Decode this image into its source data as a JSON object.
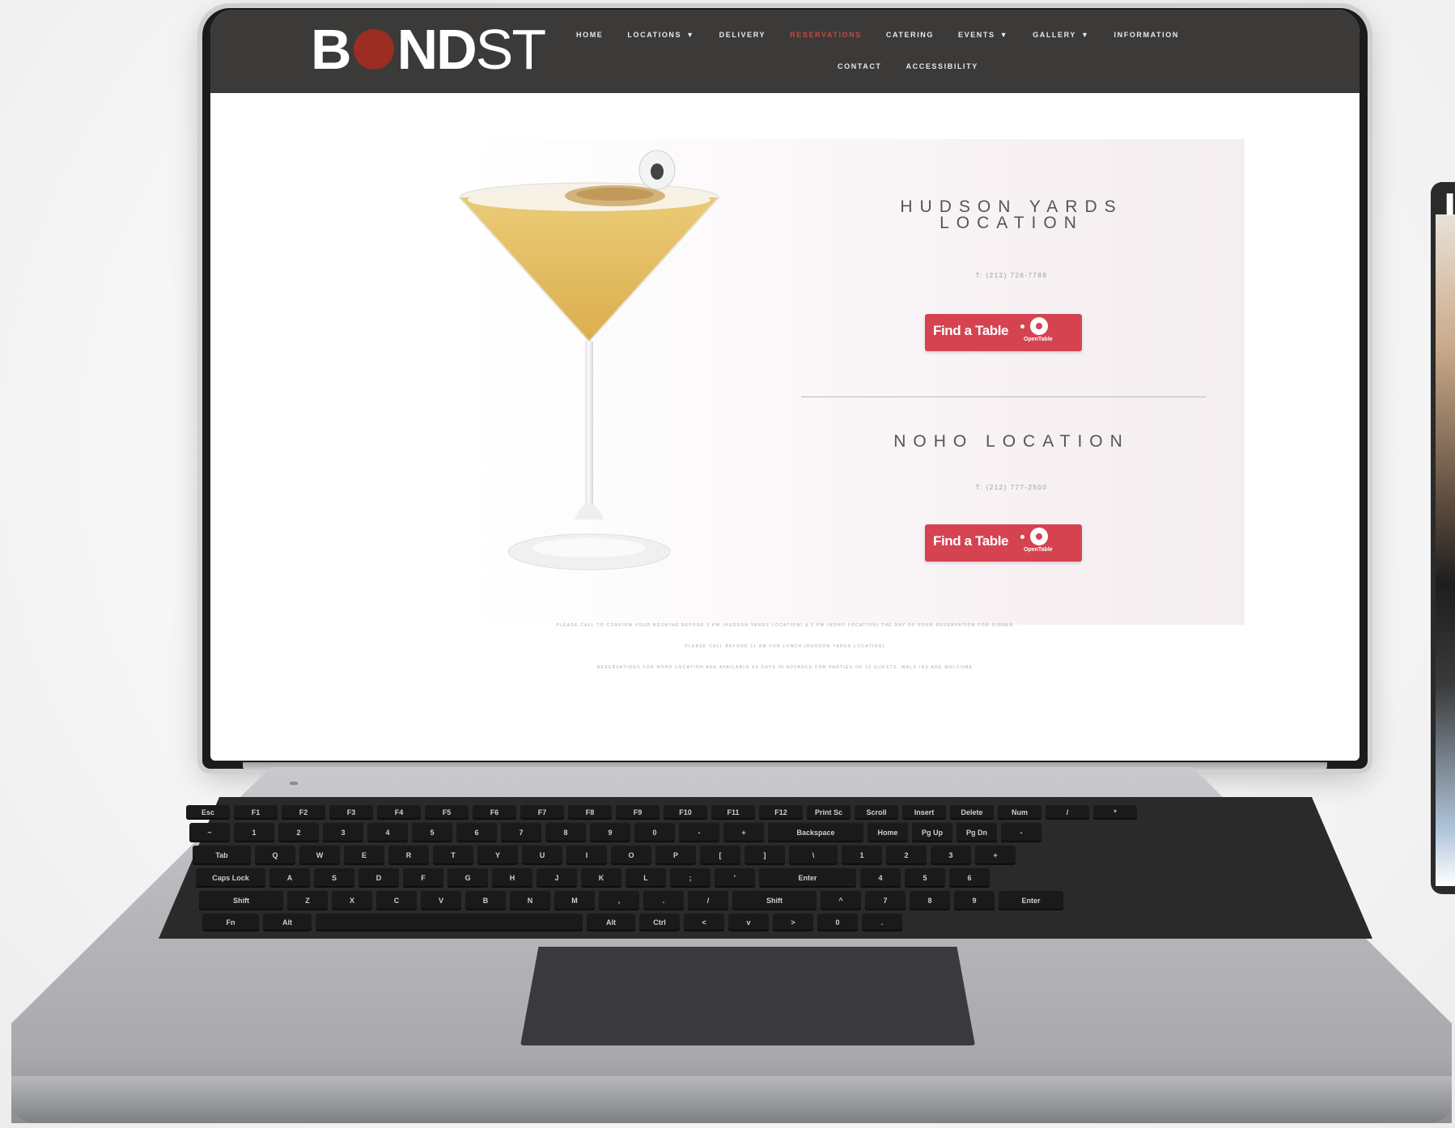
{
  "site": {
    "logo_first": "B",
    "logo_bold": "ND",
    "logo_light": "ST"
  },
  "nav": {
    "row1": [
      {
        "label": "HOME",
        "has_dropdown": false,
        "active": false
      },
      {
        "label": "LOCATIONS",
        "has_dropdown": true,
        "active": false
      },
      {
        "label": "DELIVERY",
        "has_dropdown": false,
        "active": false
      },
      {
        "label": "RESERVATIONS",
        "has_dropdown": false,
        "active": true
      },
      {
        "label": "CATERING",
        "has_dropdown": false,
        "active": false
      },
      {
        "label": "EVENTS",
        "has_dropdown": true,
        "active": false
      },
      {
        "label": "GALLERY",
        "has_dropdown": true,
        "active": false
      },
      {
        "label": "INFORMATION",
        "has_dropdown": false,
        "active": false
      }
    ],
    "row2": [
      {
        "label": "CONTACT",
        "has_dropdown": false,
        "active": false
      },
      {
        "label": "ACCESSIBILITY",
        "has_dropdown": false,
        "active": false
      }
    ],
    "active_color": "#c34a45"
  },
  "locations": [
    {
      "title_line1": "HUDSON YARDS",
      "title_line2": "LOCATION",
      "phone": "T: (212) 726-7788",
      "button_label": "Find a Table",
      "button_brand": "OpenTable"
    },
    {
      "title_line1": "NOHO LOCATION",
      "title_line2": "",
      "phone": "T: (212) 777-2500",
      "button_label": "Find a Table",
      "button_brand": "OpenTable"
    }
  ],
  "notes": [
    "PLEASE CALL TO CONFIRM YOUR BOOKING BEFORE 5 PM (HUDSON YARDS LOCATION) & 2 PM (NOHO LOCATION) THE DAY OF YOUR RESERVATION FOR DINNER",
    "PLEASE CALL BEFORE 11 AM FOR LUNCH (HUDSON YARDS LOCATION)",
    "RESERVATIONS FOR NOHO LOCATION ARE AVAILABLE 60 DAYS IN ADVANCE FOR PARTIES OF 10 GUESTS. WALK INS ARE WELCOME"
  ],
  "keyboard": {
    "fn_row": [
      "Esc",
      "F1",
      "F2",
      "F3",
      "F4",
      "F5",
      "F6",
      "F7",
      "F8",
      "F9",
      "F10",
      "F11",
      "F12",
      "Print Sc",
      "Scroll",
      "Insert",
      "Delete",
      "Num",
      "/",
      "*"
    ],
    "num_row": [
      "~",
      "1",
      "2",
      "3",
      "4",
      "5",
      "6",
      "7",
      "8",
      "9",
      "0",
      "-",
      "+",
      "Backspace",
      "Home",
      "Pg Up",
      "Pg Dn",
      "-"
    ],
    "q_row": [
      "Tab",
      "Q",
      "W",
      "E",
      "R",
      "T",
      "Y",
      "U",
      "I",
      "O",
      "P",
      "[",
      "]",
      "\\",
      "1",
      "2",
      "3",
      "+"
    ],
    "a_row": [
      "Caps Lock",
      "A",
      "S",
      "D",
      "F",
      "G",
      "H",
      "J",
      "K",
      "L",
      ";",
      "'",
      "Enter",
      "4",
      "5",
      "6"
    ],
    "z_row": [
      "Shift",
      "Z",
      "X",
      "C",
      "V",
      "B",
      "N",
      "M",
      ",",
      ".",
      "/",
      "Shift",
      "^",
      "7",
      "8",
      "9",
      "Enter"
    ],
    "bottom_row": [
      "Fn",
      "Alt",
      "",
      "Alt",
      "Ctrl",
      "<",
      "v",
      ">",
      "0",
      "."
    ]
  },
  "colors": {
    "navbar": "#3b3a39",
    "logo_dot": "#9b2d22",
    "button": "#d64350"
  }
}
